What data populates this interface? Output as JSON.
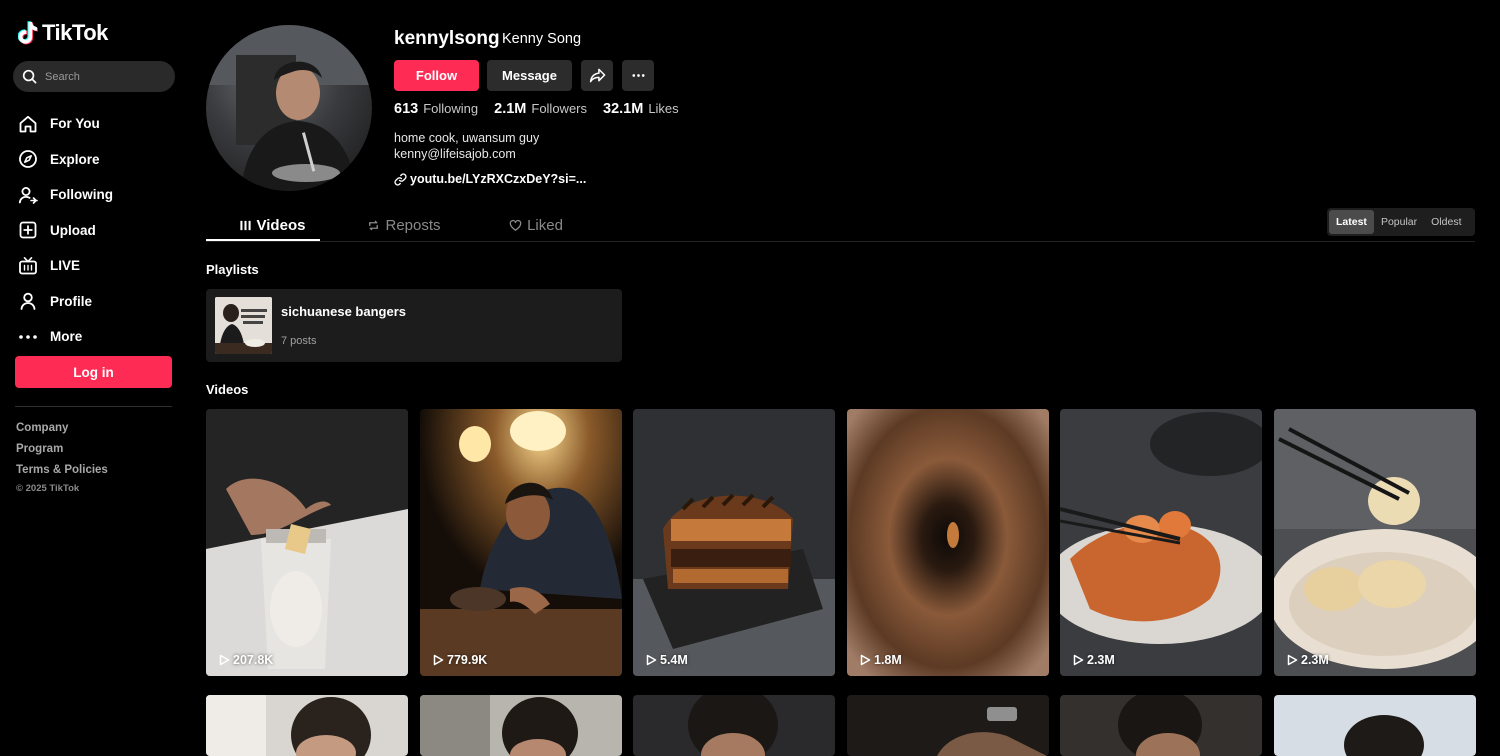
{
  "app": {
    "brand": "TikTok",
    "accent": "#fe2c55"
  },
  "search": {
    "placeholder": "Search"
  },
  "nav": {
    "items": [
      {
        "label": "For You",
        "icon": "home-icon"
      },
      {
        "label": "Explore",
        "icon": "compass-icon"
      },
      {
        "label": "Following",
        "icon": "user-follow-icon"
      },
      {
        "label": "Upload",
        "icon": "upload-icon"
      },
      {
        "label": "LIVE",
        "icon": "live-icon"
      },
      {
        "label": "Profile",
        "icon": "person-icon"
      },
      {
        "label": "More",
        "icon": "more-dots-icon"
      }
    ],
    "login_label": "Log in"
  },
  "footer": {
    "links": [
      "Company",
      "Program",
      "Terms & Policies"
    ],
    "copyright": "© 2025 TikTok"
  },
  "profile": {
    "username": "kennylsong",
    "nickname": "Kenny Song",
    "follow_label": "Follow",
    "message_label": "Message",
    "stats": {
      "following_count": "613",
      "following_label": "Following",
      "followers_count": "2.1M",
      "followers_label": "Followers",
      "likes_count": "32.1M",
      "likes_label": "Likes"
    },
    "bio_line1": "home cook, uwansum guy",
    "bio_line2": "kenny@lifeisajob.com",
    "link_text": "youtu.be/LYzRXCzxDeY?si=..."
  },
  "tabs": {
    "videos": "Videos",
    "reposts": "Reposts",
    "liked": "Liked",
    "active": "videos"
  },
  "sort": {
    "latest": "Latest",
    "popular": "Popular",
    "oldest": "Oldest",
    "active": "latest"
  },
  "playlists": {
    "title": "Playlists",
    "items": [
      {
        "name": "sichuanese bangers",
        "count": "7 posts"
      }
    ]
  },
  "videos": {
    "title": "Videos",
    "items": [
      {
        "views": "207.8K"
      },
      {
        "views": "779.9K"
      },
      {
        "views": "5.4M"
      },
      {
        "views": "1.8M"
      },
      {
        "views": "2.3M"
      },
      {
        "views": "2.3M"
      },
      {
        "views": ""
      },
      {
        "views": ""
      },
      {
        "views": ""
      },
      {
        "views": ""
      },
      {
        "views": ""
      },
      {
        "views": ""
      }
    ]
  }
}
